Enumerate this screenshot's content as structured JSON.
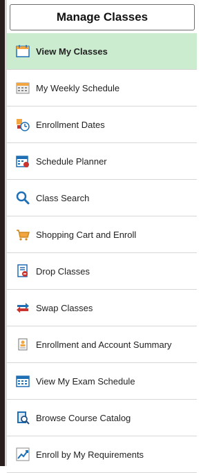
{
  "header": {
    "title": "Manage Classes"
  },
  "menu": [
    {
      "label": "View My Classes"
    },
    {
      "label": "My Weekly Schedule"
    },
    {
      "label": "Enrollment Dates"
    },
    {
      "label": "Schedule Planner"
    },
    {
      "label": "Class Search"
    },
    {
      "label": "Shopping Cart and Enroll"
    },
    {
      "label": "Drop Classes"
    },
    {
      "label": "Swap Classes"
    },
    {
      "label": "Enrollment and Account Summary"
    },
    {
      "label": "View My Exam Schedule"
    },
    {
      "label": "Browse Course Catalog"
    },
    {
      "label": "Enroll by My Requirements"
    }
  ],
  "colors": {
    "active_bg": "#cbeccf",
    "accent_blue": "#1f6fb5",
    "accent_orange": "#f2a541",
    "accent_red": "#c9342f"
  }
}
